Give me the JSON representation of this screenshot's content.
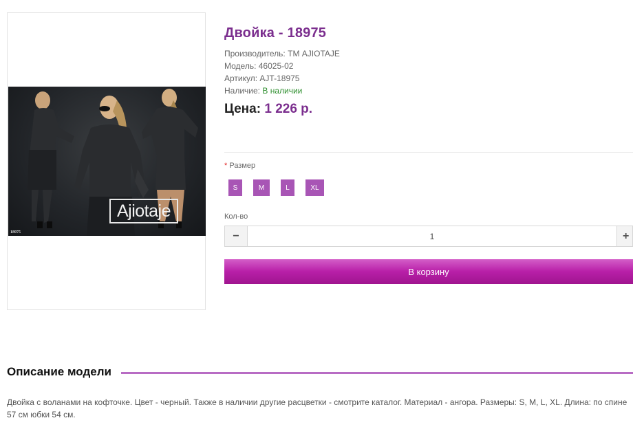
{
  "product": {
    "title": "Двойка - 18975",
    "manufacturer_label": "Производитель:",
    "manufacturer": "ТМ AJIOTAJE",
    "model_label": "Модель:",
    "model": "46025-02",
    "sku_label": "Артикул:",
    "sku": "AJT-18975",
    "availability_label": "Наличие:",
    "availability": "В наличии",
    "price_label": "Цена:",
    "price": "1 226 р."
  },
  "image": {
    "brand_logo": "Ajiotaje",
    "code": "18975"
  },
  "options": {
    "size_label": "Размер",
    "required_mark": "*",
    "sizes": [
      "S",
      "M",
      "L",
      "XL"
    ]
  },
  "quantity": {
    "label": "Кол-во",
    "value": "1",
    "minus_icon": "−",
    "plus_icon": "+"
  },
  "cart": {
    "button_label": "В корзину"
  },
  "description": {
    "heading": "Описание модели",
    "text": "Двойка с воланами на кофточке. Цвет - черный. Также в наличии другие расцветки - смотрите каталог. Материал - ангора. Размеры: S, M, L, XL. Длина: по спине 57 см юбки 54 см."
  },
  "colors": {
    "accent": "#7b2e8e",
    "size_button": "#a855b5",
    "cart_button": "#b81fa8",
    "available": "#2f8f2f"
  }
}
